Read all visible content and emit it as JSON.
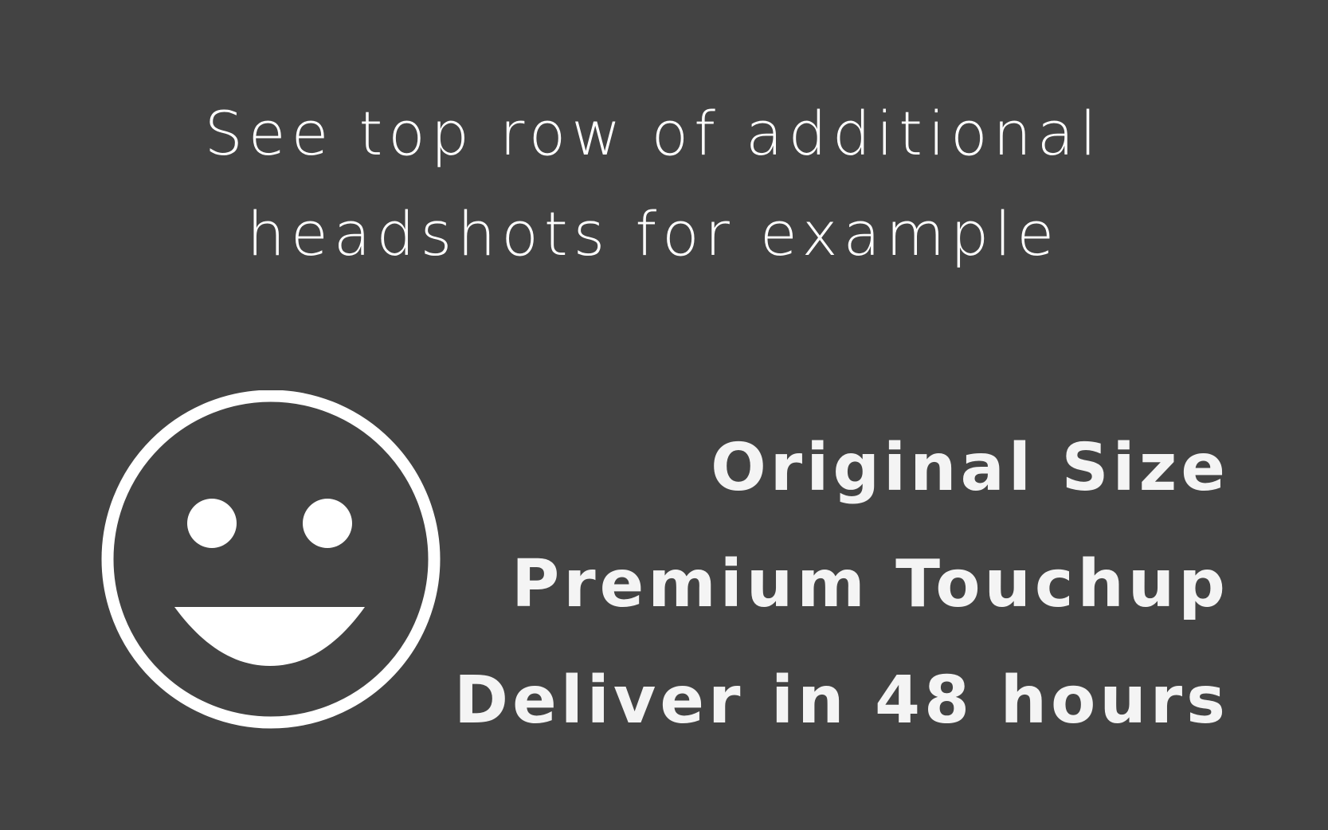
{
  "headline": {
    "line1": "See top row of additional",
    "line2": "headshots for example"
  },
  "features": [
    "Original Size",
    "Premium Touchup",
    "Deliver in 48 hours"
  ],
  "icon": "smiley-face-icon",
  "colors": {
    "background": "#434343",
    "text": "#ffffff"
  }
}
